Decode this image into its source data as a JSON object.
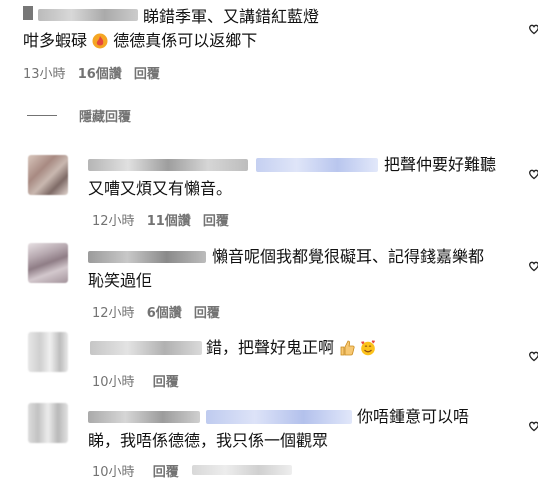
{
  "comments": [
    {
      "line1": "睇錯季軍、又講錯紅藍燈",
      "line2": "咁多蝦碌",
      "line2b": "德德真係可以返鄉下",
      "time": "13小時",
      "likes": "16個讚",
      "reply": "回覆"
    },
    {
      "line1": "把聲仲要好難聽",
      "line2": "又嘈又煩又有懶音。",
      "time": "12小時",
      "likes": "11個讚",
      "reply": "回覆"
    },
    {
      "line1": "懶音呢個我都覺很礙耳、記得錢嘉樂都",
      "line2": "恥笑過佢",
      "time": "12小時",
      "likes": "6個讚",
      "reply": "回覆"
    },
    {
      "line1": "錯，把聲好鬼正啊",
      "time": "10小時",
      "reply": "回覆"
    },
    {
      "line1": "你唔鍾意可以唔",
      "line2": "睇，我唔係德德，我只係一個觀眾",
      "time": "10小時",
      "reply": "回覆"
    }
  ],
  "hide_replies": "隱藏回覆",
  "colors": {
    "meta": "#737373",
    "text": "#111111",
    "mention_blue": "#c9d4f3"
  }
}
